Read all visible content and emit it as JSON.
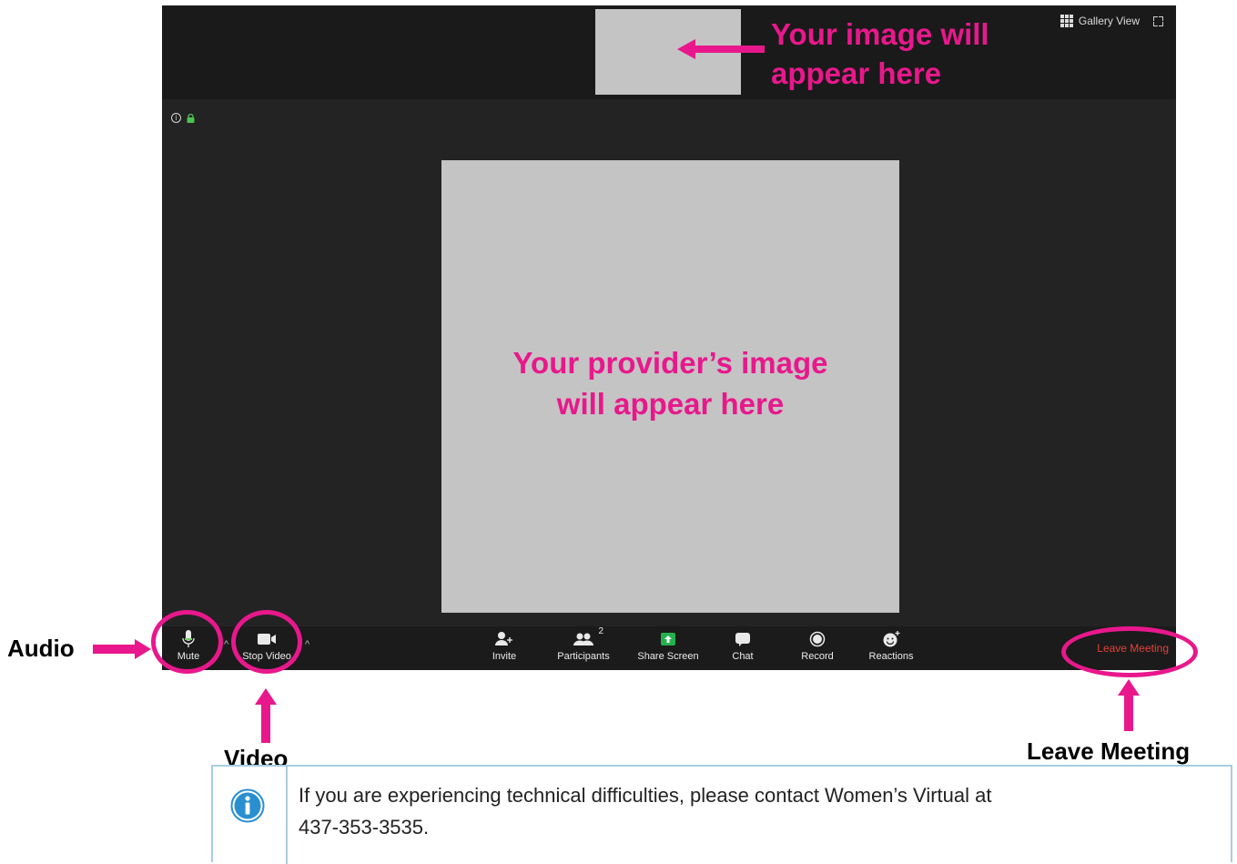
{
  "window": {
    "gallery_view_label": "Gallery View"
  },
  "tiles": {
    "self_caption": "Your image will appear here",
    "self_caption_line1": "Your image will",
    "self_caption_line2": "appear here",
    "provider_caption_line1": "Your provider’s image",
    "provider_caption_line2": "will appear here"
  },
  "toolbar": {
    "mute_label": "Mute",
    "stop_video_label": "Stop Video",
    "invite_label": "Invite",
    "participants_label": "Participants",
    "participants_count": "2",
    "share_screen_label": "Share Screen",
    "chat_label": "Chat",
    "record_label": "Record",
    "reactions_label": "Reactions",
    "leave_label": "Leave Meeting"
  },
  "annotations": {
    "audio": "Audio",
    "video": "Video",
    "leave_meeting": "Leave Meeting"
  },
  "note": {
    "text_line1": "If you are experiencing technical difficulties, please contact Women’s Virtual at",
    "text_line2": "437-353-3535."
  },
  "colors": {
    "annotation_magenta": "#e8188c",
    "leave_red": "#e5413a",
    "share_green": "#23b14d",
    "note_border": "#a7cde0",
    "info_blue": "#2a8fd0"
  }
}
